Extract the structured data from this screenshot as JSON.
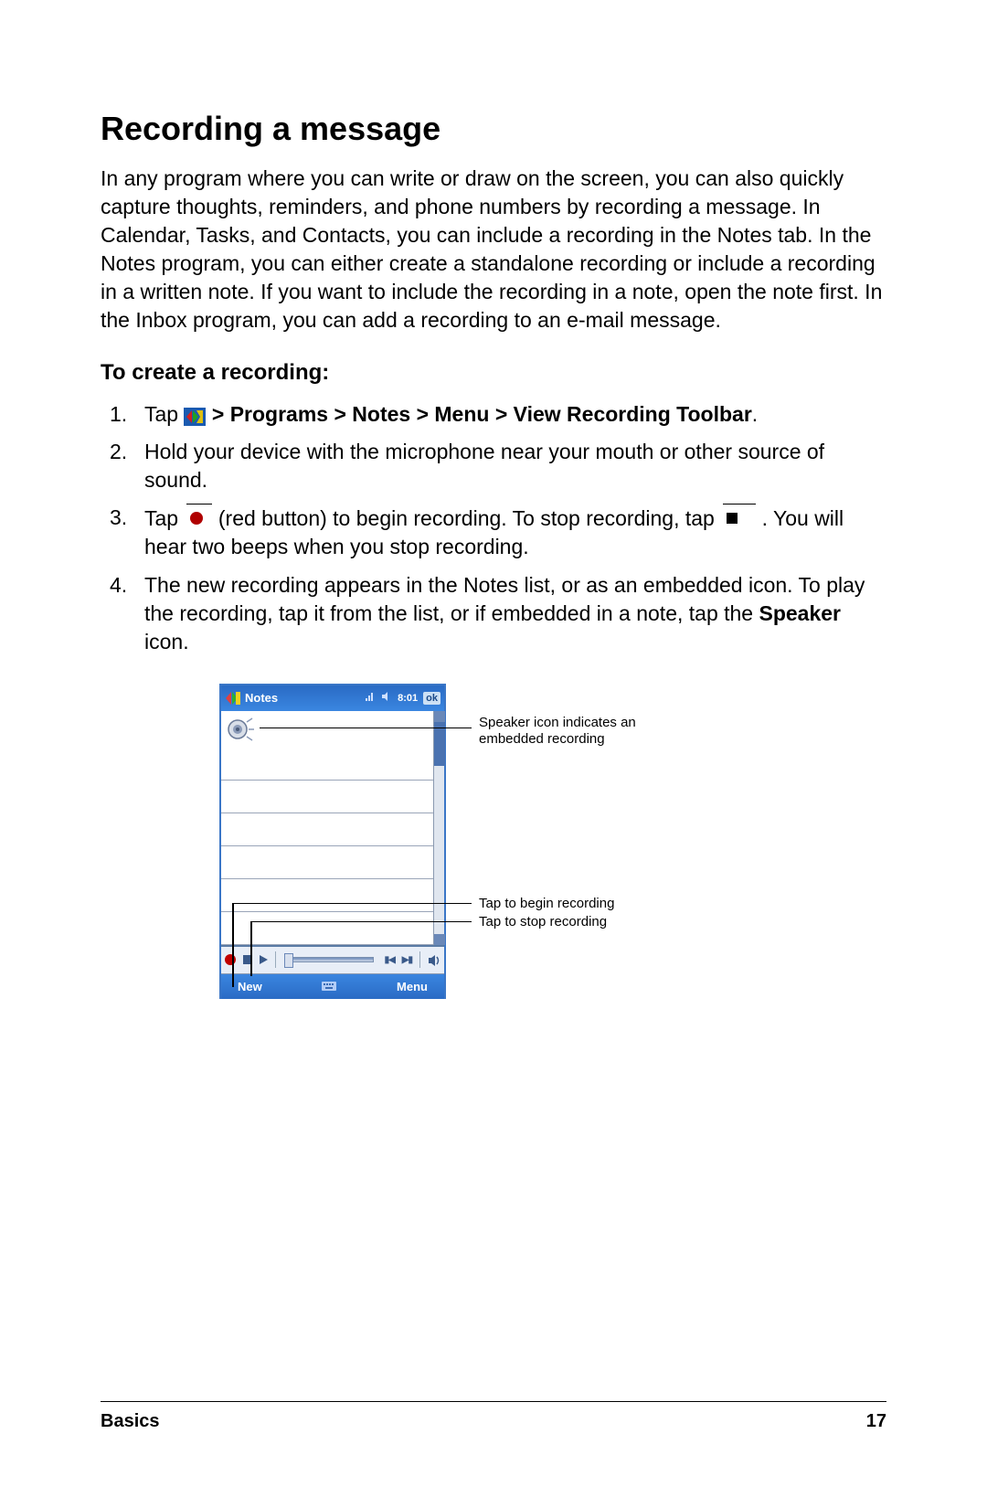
{
  "heading": "Recording a message",
  "intro": "In any program where you can write or draw on the screen, you can also quickly capture thoughts, reminders, and phone numbers by recording a message. In Calendar, Tasks, and Contacts, you can include a recording in the Notes tab. In the Notes program, you can either create a standalone recording or include a recording in a written note. If you want to include the recording in a note, open the note first. In the Inbox program, you can add a recording to an e-mail message.",
  "subheading": "To create a recording:",
  "steps": {
    "s1_prefix": "Tap ",
    "s1_path": " > Programs > Notes > Menu > View Recording Toolbar",
    "s1_suffix": ".",
    "s2": "Hold your device with the microphone near your mouth or other source of sound.",
    "s3_prefix": "Tap ",
    "s3_mid": " (red button) to begin recording. To stop recording, tap ",
    "s3_suffix": " . You will hear two beeps when you stop recording.",
    "s4_a": "The new recording appears in the Notes list, or as an embedded icon. To play the recording, tap it from the list, or if embedded in a note, tap the ",
    "s4_b": "Speaker",
    "s4_c": " icon."
  },
  "screenshot": {
    "title": "Notes",
    "time": "8:01",
    "ok": "ok",
    "menu_new": "New",
    "menu_menu": "Menu"
  },
  "callouts": {
    "speaker": "Speaker icon indicates an embedded recording",
    "begin": "Tap to begin recording",
    "stop": "Tap to stop recording"
  },
  "footer": {
    "section": "Basics",
    "page": "17"
  }
}
